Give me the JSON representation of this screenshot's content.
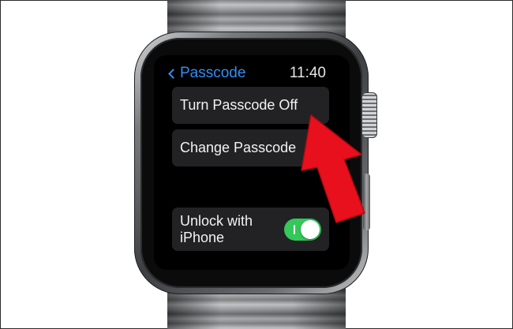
{
  "app": {
    "back_label": "Passcode",
    "time": "11:40"
  },
  "menu": {
    "items": [
      {
        "label": "Turn Passcode Off"
      },
      {
        "label": "Change Passcode"
      }
    ]
  },
  "unlock": {
    "label": "Unlock with iPhone",
    "toggle_on": true
  },
  "colors": {
    "accent": "#2f8ff5",
    "toggle_on": "#34c759",
    "annotation": "#e8101c"
  },
  "icons": {
    "back": "chevron-left-icon",
    "annotation": "red-arrow-icon"
  }
}
